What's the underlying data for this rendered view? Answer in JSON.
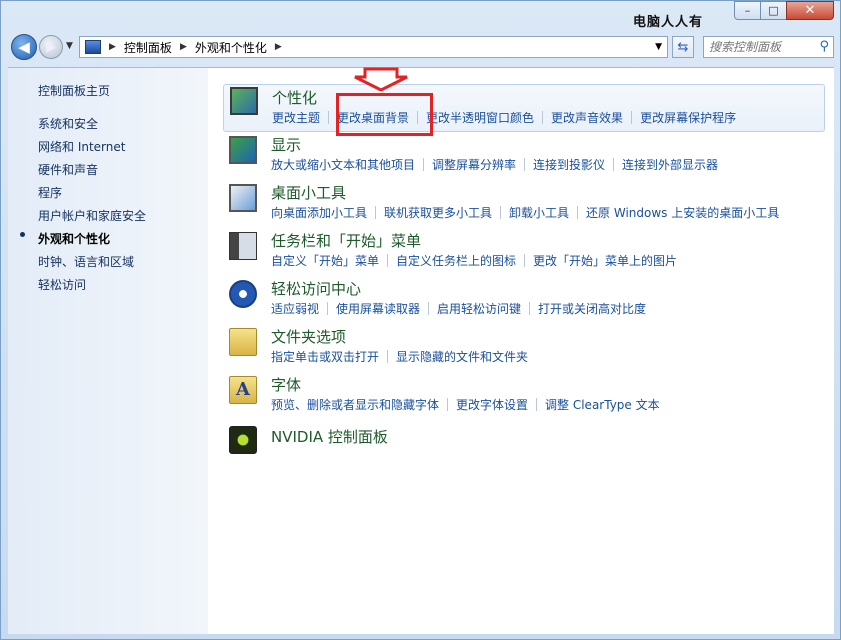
{
  "window": {
    "watermark": "电脑人人有",
    "buttons": {
      "minimize": "–",
      "maximize": "□",
      "close": "✕"
    }
  },
  "toolbar": {
    "back_icon": "back-arrow-icon",
    "forward_icon": "forward-arrow-icon",
    "breadcrumb": [
      "控制面板",
      "外观和个性化"
    ],
    "search_placeholder": "搜索控制面板"
  },
  "sidebar": {
    "items": [
      {
        "label": "控制面板主页",
        "current": false
      },
      {
        "label": "系统和安全",
        "current": false
      },
      {
        "label": "网络和 Internet",
        "current": false
      },
      {
        "label": "硬件和声音",
        "current": false
      },
      {
        "label": "程序",
        "current": false
      },
      {
        "label": "用户帐户和家庭安全",
        "current": false
      },
      {
        "label": "外观和个性化",
        "current": true
      },
      {
        "label": "时钟、语言和区域",
        "current": false
      },
      {
        "label": "轻松访问",
        "current": false
      }
    ]
  },
  "categories": [
    {
      "title": "个性化",
      "icon": "personalization-icon",
      "links": [
        "更改主题",
        "更改桌面背景",
        "更改半透明窗口颜色",
        "更改声音效果",
        "更改屏幕保护程序"
      ]
    },
    {
      "title": "显示",
      "icon": "display-icon",
      "links": [
        "放大或缩小文本和其他项目",
        "调整屏幕分辨率",
        "连接到投影仪",
        "连接到外部显示器"
      ]
    },
    {
      "title": "桌面小工具",
      "icon": "gadgets-icon",
      "links": [
        "向桌面添加小工具",
        "联机获取更多小工具",
        "卸载小工具",
        "还原 Windows 上安装的桌面小工具"
      ]
    },
    {
      "title": "任务栏和「开始」菜单",
      "icon": "taskbar-icon",
      "links": [
        "自定义「开始」菜单",
        "自定义任务栏上的图标",
        "更改「开始」菜单上的图片"
      ]
    },
    {
      "title": "轻松访问中心",
      "icon": "ease-of-access-icon",
      "links": [
        "适应弱视",
        "使用屏幕读取器",
        "启用轻松访问键",
        "打开或关闭高对比度"
      ]
    },
    {
      "title": "文件夹选项",
      "icon": "folder-options-icon",
      "links": [
        "指定单击或双击打开",
        "显示隐藏的文件和文件夹"
      ]
    },
    {
      "title": "字体",
      "icon": "fonts-icon",
      "links": [
        "预览、删除或者显示和隐藏字体",
        "更改字体设置",
        "调整 ClearType 文本"
      ]
    },
    {
      "title": "NVIDIA 控制面板",
      "icon": "nvidia-icon",
      "links": []
    }
  ],
  "annotation": {
    "color": "#e32323"
  }
}
